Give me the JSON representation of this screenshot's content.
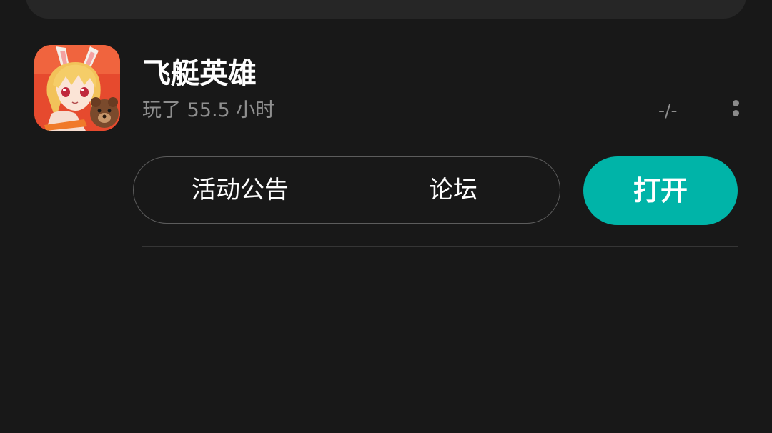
{
  "game": {
    "title": "飞艇英雄",
    "playtime": "玩了 55.5 小时",
    "rank": "-/-",
    "icon": "game-app-icon"
  },
  "actions": {
    "announcements_label": "活动公告",
    "forum_label": "论坛",
    "open_label": "打开"
  },
  "colors": {
    "background": "#181818",
    "card": "#262626",
    "accent": "#00b4a8",
    "secondary_text": "#8e8e8e"
  }
}
